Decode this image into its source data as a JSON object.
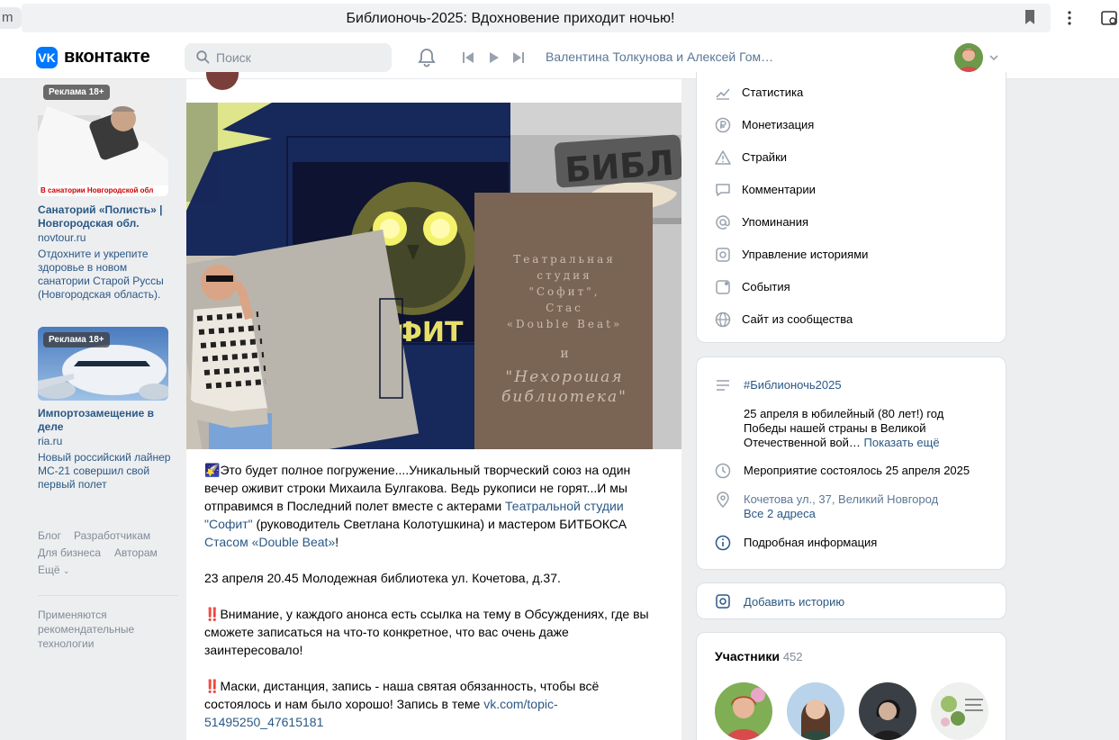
{
  "browser": {
    "url_fragment": "m",
    "page_title": "Библионочь-2025: Вдохновение приходит ночью!"
  },
  "header": {
    "logo_letters": "VK",
    "brand": "вконтакте",
    "search_placeholder": "Поиск",
    "now_playing": "Валентина Толкунова и Алексей Гом…"
  },
  "ads": [
    {
      "badge": "Реклама 18+",
      "caption": "В санатории Новгородской обл",
      "title": "Санаторий «Полисть» | Новгородская обл.",
      "domain": "novtour.ru",
      "description": "Отдохните и укрепите здоровье в новом санатории Старой Руссы (Новгородская область)."
    },
    {
      "badge": "Реклама 18+",
      "title": "Импортозамещение в деле",
      "domain": "ria.ru",
      "description": "Новый российский лайнер МС-21 совершил свой первый полет"
    }
  ],
  "footer_links": {
    "blog": "Блог",
    "developers": "Разработчикам",
    "business": "Для бизнеса",
    "authors": "Авторам",
    "more": "Ещё"
  },
  "recommend_note": "Применяются рекомендательные технологии",
  "post": {
    "image_texts": {
      "logo_word": "СОФИТ",
      "sign_word": "БИБЛ",
      "line1": "Театральная",
      "line2": "студия",
      "line3": "\"Софит\",",
      "line4": "Стас",
      "line5": "«Double Beat»",
      "line6": "и",
      "line7": "\"Нехорошая",
      "line8": "библиотека\""
    },
    "p1_icon": "🌠",
    "p1_a": "Это будет полное погружение....Уникальный творческий союз на один вечер оживит строки Михаила Булгакова. Ведь рукописи не горят...И мы отправимся в Последний полет вместе с актерами ",
    "p1_link1": "Театральной студии \"Софит\"",
    "p1_b": " (руководитель Светлана Колотушкина) и мастером БИТБОКСА ",
    "p1_link2": "Стасом «Double Beat»",
    "p1_c": "!",
    "p2": "23 апреля 20.45 Молодежная библиотека ул. Кочетова, д.37.",
    "p3_icon": "‼️",
    "p3": "Внимание, у каждого анонса есть ссылка на тему в Обсуждениях, где вы сможете записаться на что-то конкретное, что вас очень даже заинтересовало!",
    "p4_icon": "‼️",
    "p4": "Маски, дистанция, запись - наша святая обязанность, чтобы всё состоялось и нам было хорошо! Запись в теме ",
    "p4_link": "vk.com/topic-51495250_47615181"
  },
  "admin_menu": [
    {
      "icon": "stats-icon",
      "label": "Статистика"
    },
    {
      "icon": "ruble-icon",
      "label": "Монетизация"
    },
    {
      "icon": "warning-icon",
      "label": "Страйки"
    },
    {
      "icon": "comment-icon",
      "label": "Комментарии"
    },
    {
      "icon": "at-icon",
      "label": "Упоминания"
    },
    {
      "icon": "stories-icon",
      "label": "Управление историями"
    },
    {
      "icon": "events-icon",
      "label": "События"
    },
    {
      "icon": "globe-icon",
      "label": "Сайт из сообщества"
    }
  ],
  "info": {
    "hashtag": "#Библионочь2025",
    "description": "25 апреля в юбилейный (80 лет!) год Победы нашей страны в Великой Отечественной вой…",
    "show_more": "Показать ещё",
    "event_status": "Мероприятие состоялось 25 апреля 2025",
    "address": "Кочетова ул., 37, Великий Новгород",
    "all_addresses": "Все 2 адреса",
    "details": "Подробная информация"
  },
  "add_story": "Добавить историю",
  "members": {
    "title": "Участники",
    "count": "452"
  },
  "colors": {
    "vk_blue": "#0077ff",
    "link": "#2a5885",
    "muted": "#818c99",
    "page_bg": "#edeef0"
  }
}
